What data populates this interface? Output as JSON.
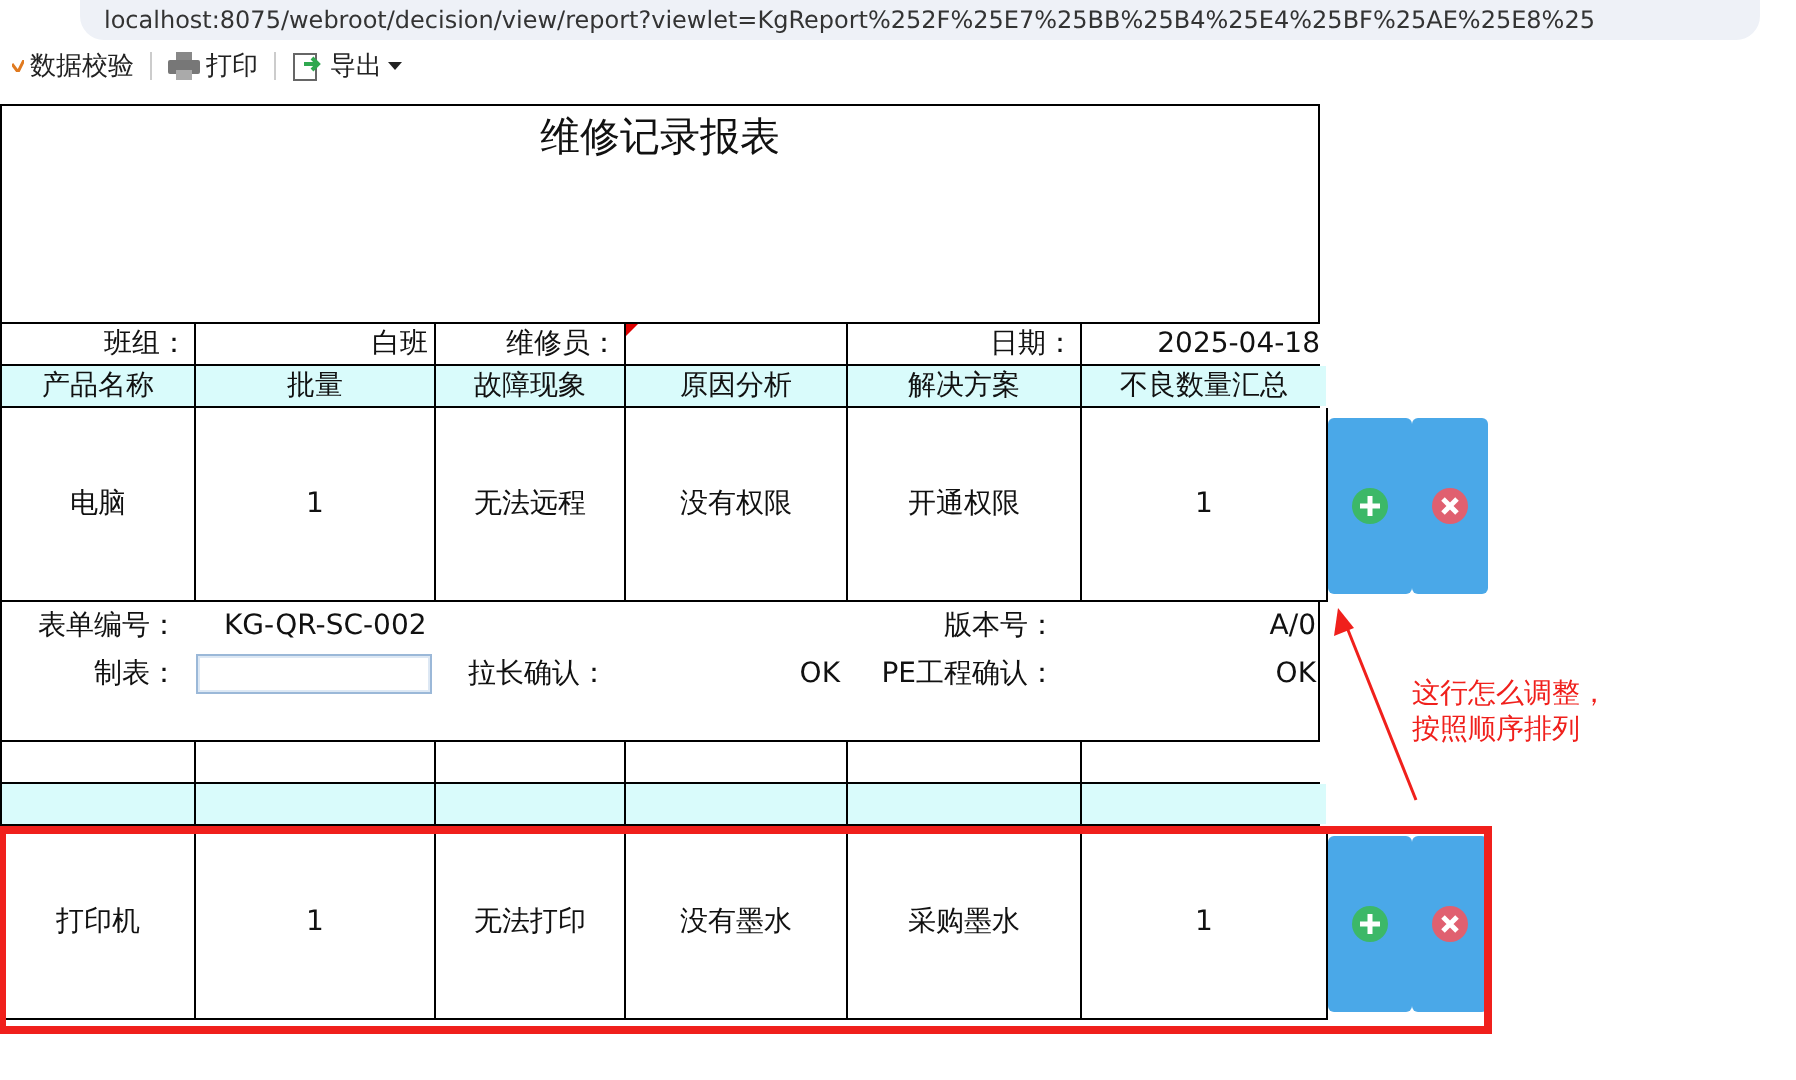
{
  "address_bar": {
    "url": "localhost:8075/webroot/decision/view/report?viewlet=KgReport%252F%25E7%25BB%25B4%25E4%25BF%25AE%25E8%25"
  },
  "toolbar": [
    {
      "kind": "validate",
      "label": "数据校验"
    },
    {
      "kind": "print",
      "label": "打印"
    },
    {
      "kind": "export",
      "label": "导出",
      "dropdown": true
    }
  ],
  "report": {
    "title": "维修记录报表",
    "info": [
      {
        "text": "班组："
      },
      {
        "text": "白班"
      },
      {
        "text": "维修员："
      },
      {
        "has_comment": true
      },
      {
        "text": "日期："
      },
      {
        "text": "2025-04-18"
      }
    ],
    "columns": [
      "产品名称",
      "批量",
      "故障现象",
      "原因分析",
      "解决方案",
      "不良数量汇总"
    ],
    "records": [
      {
        "highlighted": false,
        "cells": [
          "电脑",
          "1",
          "无法远程",
          "没有权限",
          "开通权限",
          "1"
        ]
      },
      {
        "highlighted": true,
        "cells": [
          "打印机",
          "1",
          "无法打印",
          "没有墨水",
          "采购墨水",
          "1"
        ]
      }
    ],
    "footer": {
      "form_no_label": "表单编号：",
      "form_no": "KG-QR-SC-002",
      "version_label": "版本号：",
      "version": "A/0",
      "maker_label": "制表：",
      "leader_label": "拉长确认：",
      "leader": "OK",
      "pe_label": "PE工程确认：",
      "pe": "OK"
    }
  },
  "annotation": {
    "lines": [
      "这行怎么调整，",
      "按照顺序排列"
    ]
  }
}
